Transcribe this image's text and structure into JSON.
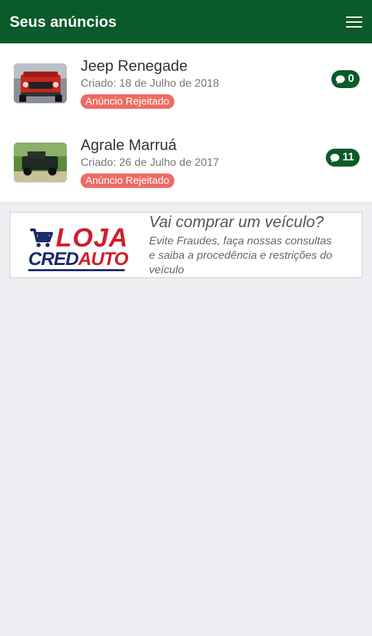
{
  "header": {
    "title": "Seus anúncios"
  },
  "listings": [
    {
      "title": "Jeep Renegade",
      "created": "Criado: 18 de Julho de 2018",
      "status": "Anúncio Rejeitado",
      "messages": "0"
    },
    {
      "title": "Agrale Marruá",
      "created": "Criado: 26 de Julho de 2017",
      "status": "Anúncio Rejeitado",
      "messages": "11"
    }
  ],
  "banner": {
    "logo_top": "LOJA",
    "logo_bottom_a": "CRED",
    "logo_bottom_b": "AUTO",
    "headline": "Vai comprar um veículo?",
    "sub_line1": "Evite Fraudes, faça nossas consultas",
    "sub_line2": "e saiba a procedência e restrições do veículo"
  }
}
